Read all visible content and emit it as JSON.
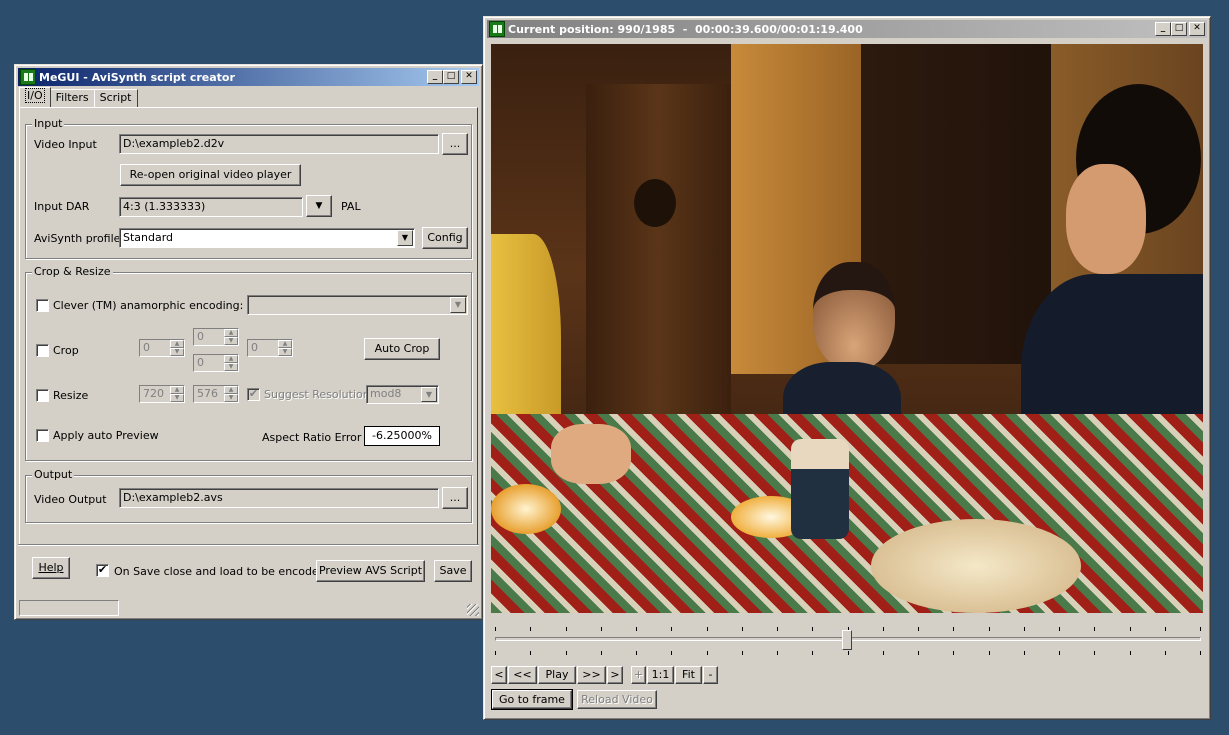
{
  "megui": {
    "title": "MeGUI - AviSynth script creator",
    "tabs": [
      "I/O",
      "Filters",
      "Script"
    ],
    "input": {
      "group_title": "Input",
      "video_input_label": "Video Input",
      "video_input_value": "D:\\exampleb2.d2v",
      "browse_label": "...",
      "reopen_label": "Re-open original video player",
      "dar_label": "Input DAR",
      "dar_value": "4:3 (1.333333)",
      "dar_dropdown": "▼",
      "dar_standard": "PAL",
      "profile_label": "AviSynth profile",
      "profile_value": "Standard",
      "config_label": "Config"
    },
    "crop": {
      "group_title": "Crop & Resize",
      "clever_label": "Clever (TM) anamorphic encoding:",
      "crop_label": "Crop",
      "crop_left": "0",
      "crop_top": "0",
      "crop_bottom": "0",
      "crop_right": "0",
      "auto_crop_label": "Auto Crop",
      "resize_label": "Resize",
      "width": "720",
      "height": "576",
      "suggest_label": "Suggest Resolution",
      "mod_value": "mod8",
      "auto_preview_label": "Apply auto Preview",
      "ar_error_label": "Aspect Ratio Error",
      "ar_error_value": "-6.25000%"
    },
    "output": {
      "group_title": "Output",
      "video_output_label": "Video Output",
      "video_output_value": "D:\\exampleb2.avs",
      "browse_label": "..."
    },
    "footer": {
      "help_label": "Help",
      "close_on_save_label": "On Save close and load to be encoded",
      "preview_label": "Preview AVS Script",
      "save_label": "Save"
    }
  },
  "player": {
    "title": "Current position: 990/1985  -  00:00:39.600/00:01:19.400",
    "position_fraction": 0.4987,
    "controls": [
      "<",
      "<<",
      "Play",
      ">>",
      ">",
      "+",
      "1:1",
      "Fit",
      "-"
    ],
    "goto_label": "Go to frame",
    "reload_label": "Reload Video"
  },
  "colors": {
    "desktop": "#2c4d6c",
    "title_active": "#0a246a",
    "face": "#d4d0c8"
  }
}
